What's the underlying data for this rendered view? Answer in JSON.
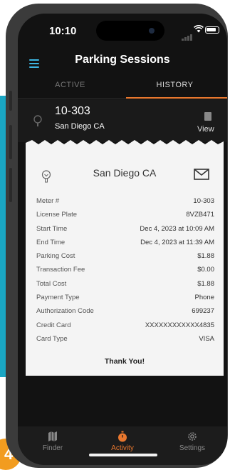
{
  "status_bar": {
    "time": "10:10"
  },
  "app_bar": {
    "title": "Parking Sessions"
  },
  "tabs": [
    {
      "label": "ACTIVE"
    },
    {
      "label": "HISTORY",
      "selected": true
    }
  ],
  "session": {
    "meter": "10-303",
    "location": "San Diego CA",
    "view_label": "View"
  },
  "receipt": {
    "location": "San Diego CA",
    "rows": [
      {
        "label": "Meter #",
        "value": "10-303"
      },
      {
        "label": "License Plate",
        "value": "8VZB471"
      },
      {
        "label": "Start Time",
        "value": "Dec 4, 2023 at 10:09 AM"
      },
      {
        "label": "End Time",
        "value": "Dec 4, 2023 at 11:39 AM"
      },
      {
        "label": "Parking Cost",
        "value": "$1.88"
      },
      {
        "label": "Transaction Fee",
        "value": "$0.00"
      },
      {
        "label": "Total Cost",
        "value": "$1.88"
      },
      {
        "label": "Payment Type",
        "value": "Phone"
      },
      {
        "label": "Authorization Code",
        "value": "699237"
      },
      {
        "label": "Credit Card",
        "value": "XXXXXXXXXXXX4835"
      },
      {
        "label": "Card Type",
        "value": "VISA"
      }
    ],
    "footer": "Thank You!"
  },
  "bottom_nav": [
    {
      "label": "Finder",
      "icon": "map-icon"
    },
    {
      "label": "Activity",
      "icon": "stopwatch-icon",
      "selected": true
    },
    {
      "label": "Settings",
      "icon": "gear-icon"
    }
  ],
  "colors": {
    "accent": "#e8772e",
    "menu": "#3db4e0",
    "screen_bg": "#121212",
    "receipt_bg": "#f4f4f4"
  }
}
